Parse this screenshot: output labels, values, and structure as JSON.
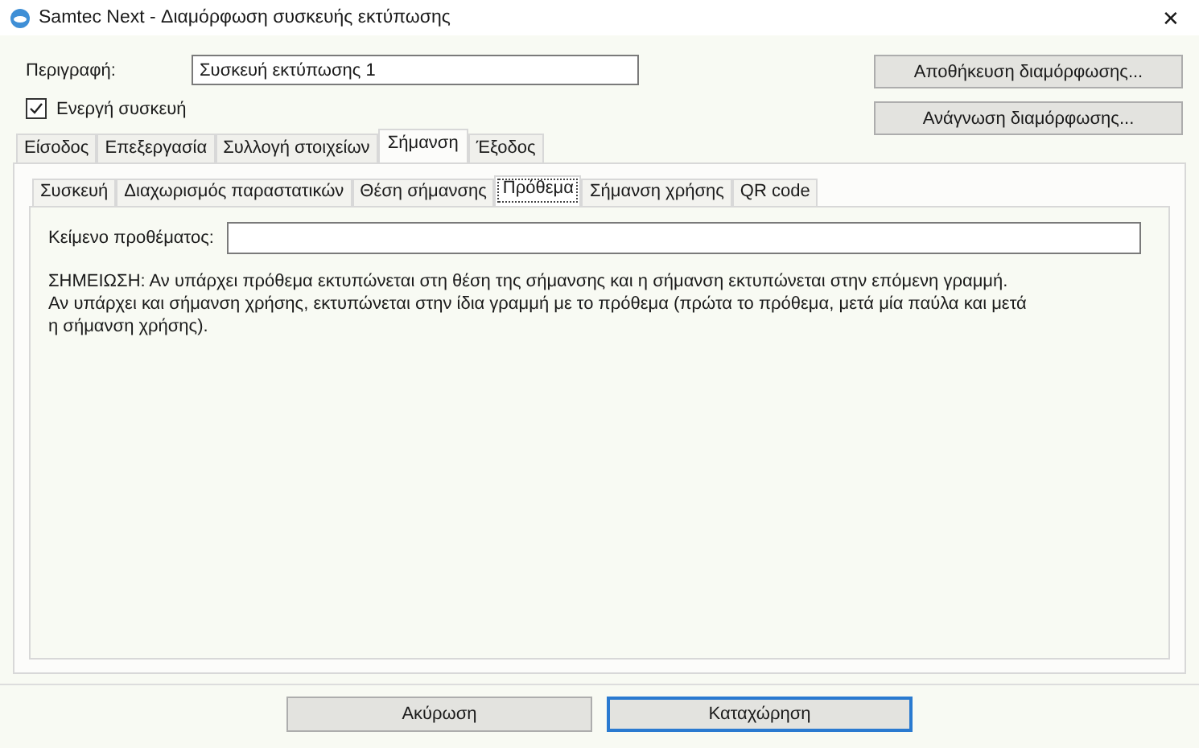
{
  "window": {
    "title": "Samtec Next - Διαμόρφωση συσκευής εκτύπωσης",
    "close": "✕"
  },
  "description": {
    "label": "Περιγραφή:",
    "value": "Συσκευή εκτύπωσης 1"
  },
  "active_device": {
    "label": "Ενεργή συσκευή",
    "checked": true
  },
  "side_buttons": [
    "Αποθήκευση διαμόρφωσης...",
    "Ανάγνωση διαμόρφωσης..."
  ],
  "tabs": [
    {
      "label": "Είσοδος",
      "selected": false
    },
    {
      "label": "Επεξεργασία",
      "selected": false
    },
    {
      "label": "Συλλογή στοιχείων",
      "selected": false
    },
    {
      "label": "Σήμανση",
      "selected": true
    },
    {
      "label": "Έξοδος",
      "selected": false
    }
  ],
  "subtabs": [
    {
      "label": "Συσκευή",
      "selected": false
    },
    {
      "label": "Διαχωρισμός παραστατικών",
      "selected": false
    },
    {
      "label": "Θέση σήμανσης",
      "selected": false
    },
    {
      "label": "Πρόθεμα",
      "selected": true
    },
    {
      "label": "Σήμανση χρήσης",
      "selected": false
    },
    {
      "label": "QR code",
      "selected": false
    }
  ],
  "prefix_field": {
    "label": "Κείμενο προθέματος:"
  },
  "note_lines": [
    "ΣΗΜΕΙΩΣΗ: Αν υπάρχει πρόθεμα εκτυπώνεται στη θέση της σήμανσης και η σήμανση εκτυπώνεται στην επόμενη γραμμή.",
    "Αν υπάρχει και σήμανση χρήσης, εκτυπώνεται στην ίδια γραμμή με το πρόθεμα (πρώτα το πρόθεμα, μετά μία παύλα και μετά",
    "η σήμανση χρήσης)."
  ],
  "buttons": [
    {
      "label": "Ακύρωση",
      "default": false
    },
    {
      "label": "Καταχώρηση",
      "default": true
    }
  ]
}
